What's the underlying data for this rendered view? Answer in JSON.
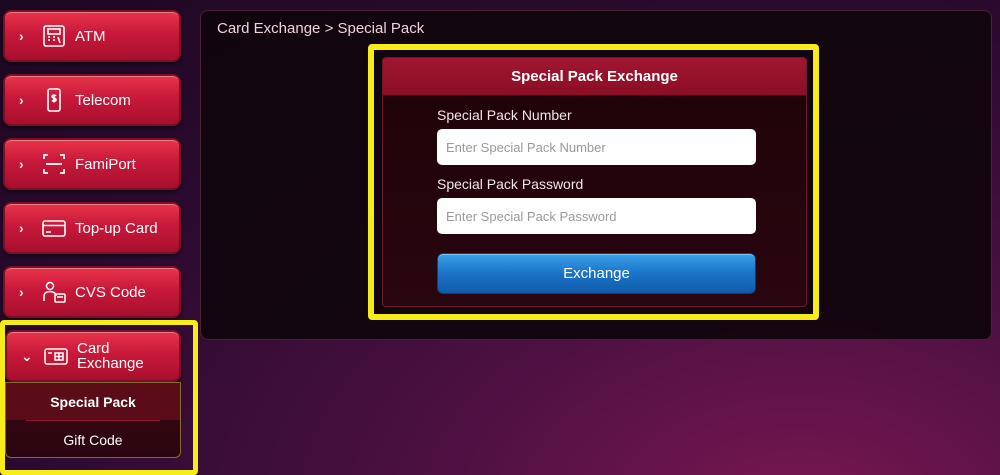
{
  "sidebar": {
    "items": [
      {
        "label": "ATM",
        "icon": "atm-icon",
        "chevron": "›"
      },
      {
        "label": "Telecom",
        "icon": "phone-dollar-icon",
        "chevron": "›"
      },
      {
        "label": "FamiPort",
        "icon": "scan-icon",
        "chevron": "›"
      },
      {
        "label": "Top-up Card",
        "icon": "card-icon",
        "chevron": "›"
      },
      {
        "label": "CVS Code",
        "icon": "cashier-icon",
        "chevron": "›"
      },
      {
        "label_line1": "Card",
        "label_line2": "Exchange",
        "icon": "gift-card-icon",
        "chevron": "⌄"
      }
    ],
    "submenu": [
      {
        "label": "Special Pack"
      },
      {
        "label": "Gift Code"
      }
    ]
  },
  "main": {
    "breadcrumb": "Card Exchange > Special Pack",
    "form": {
      "title": "Special Pack Exchange",
      "number_label": "Special Pack Number",
      "number_placeholder": "Enter Special Pack Number",
      "password_label": "Special Pack Password",
      "password_placeholder": "Enter Special Pack Password",
      "submit_label": "Exchange"
    }
  },
  "colors": {
    "highlight": "#f5ec1a",
    "nav_red": "#c8183a",
    "button_blue": "#1a72c8"
  }
}
